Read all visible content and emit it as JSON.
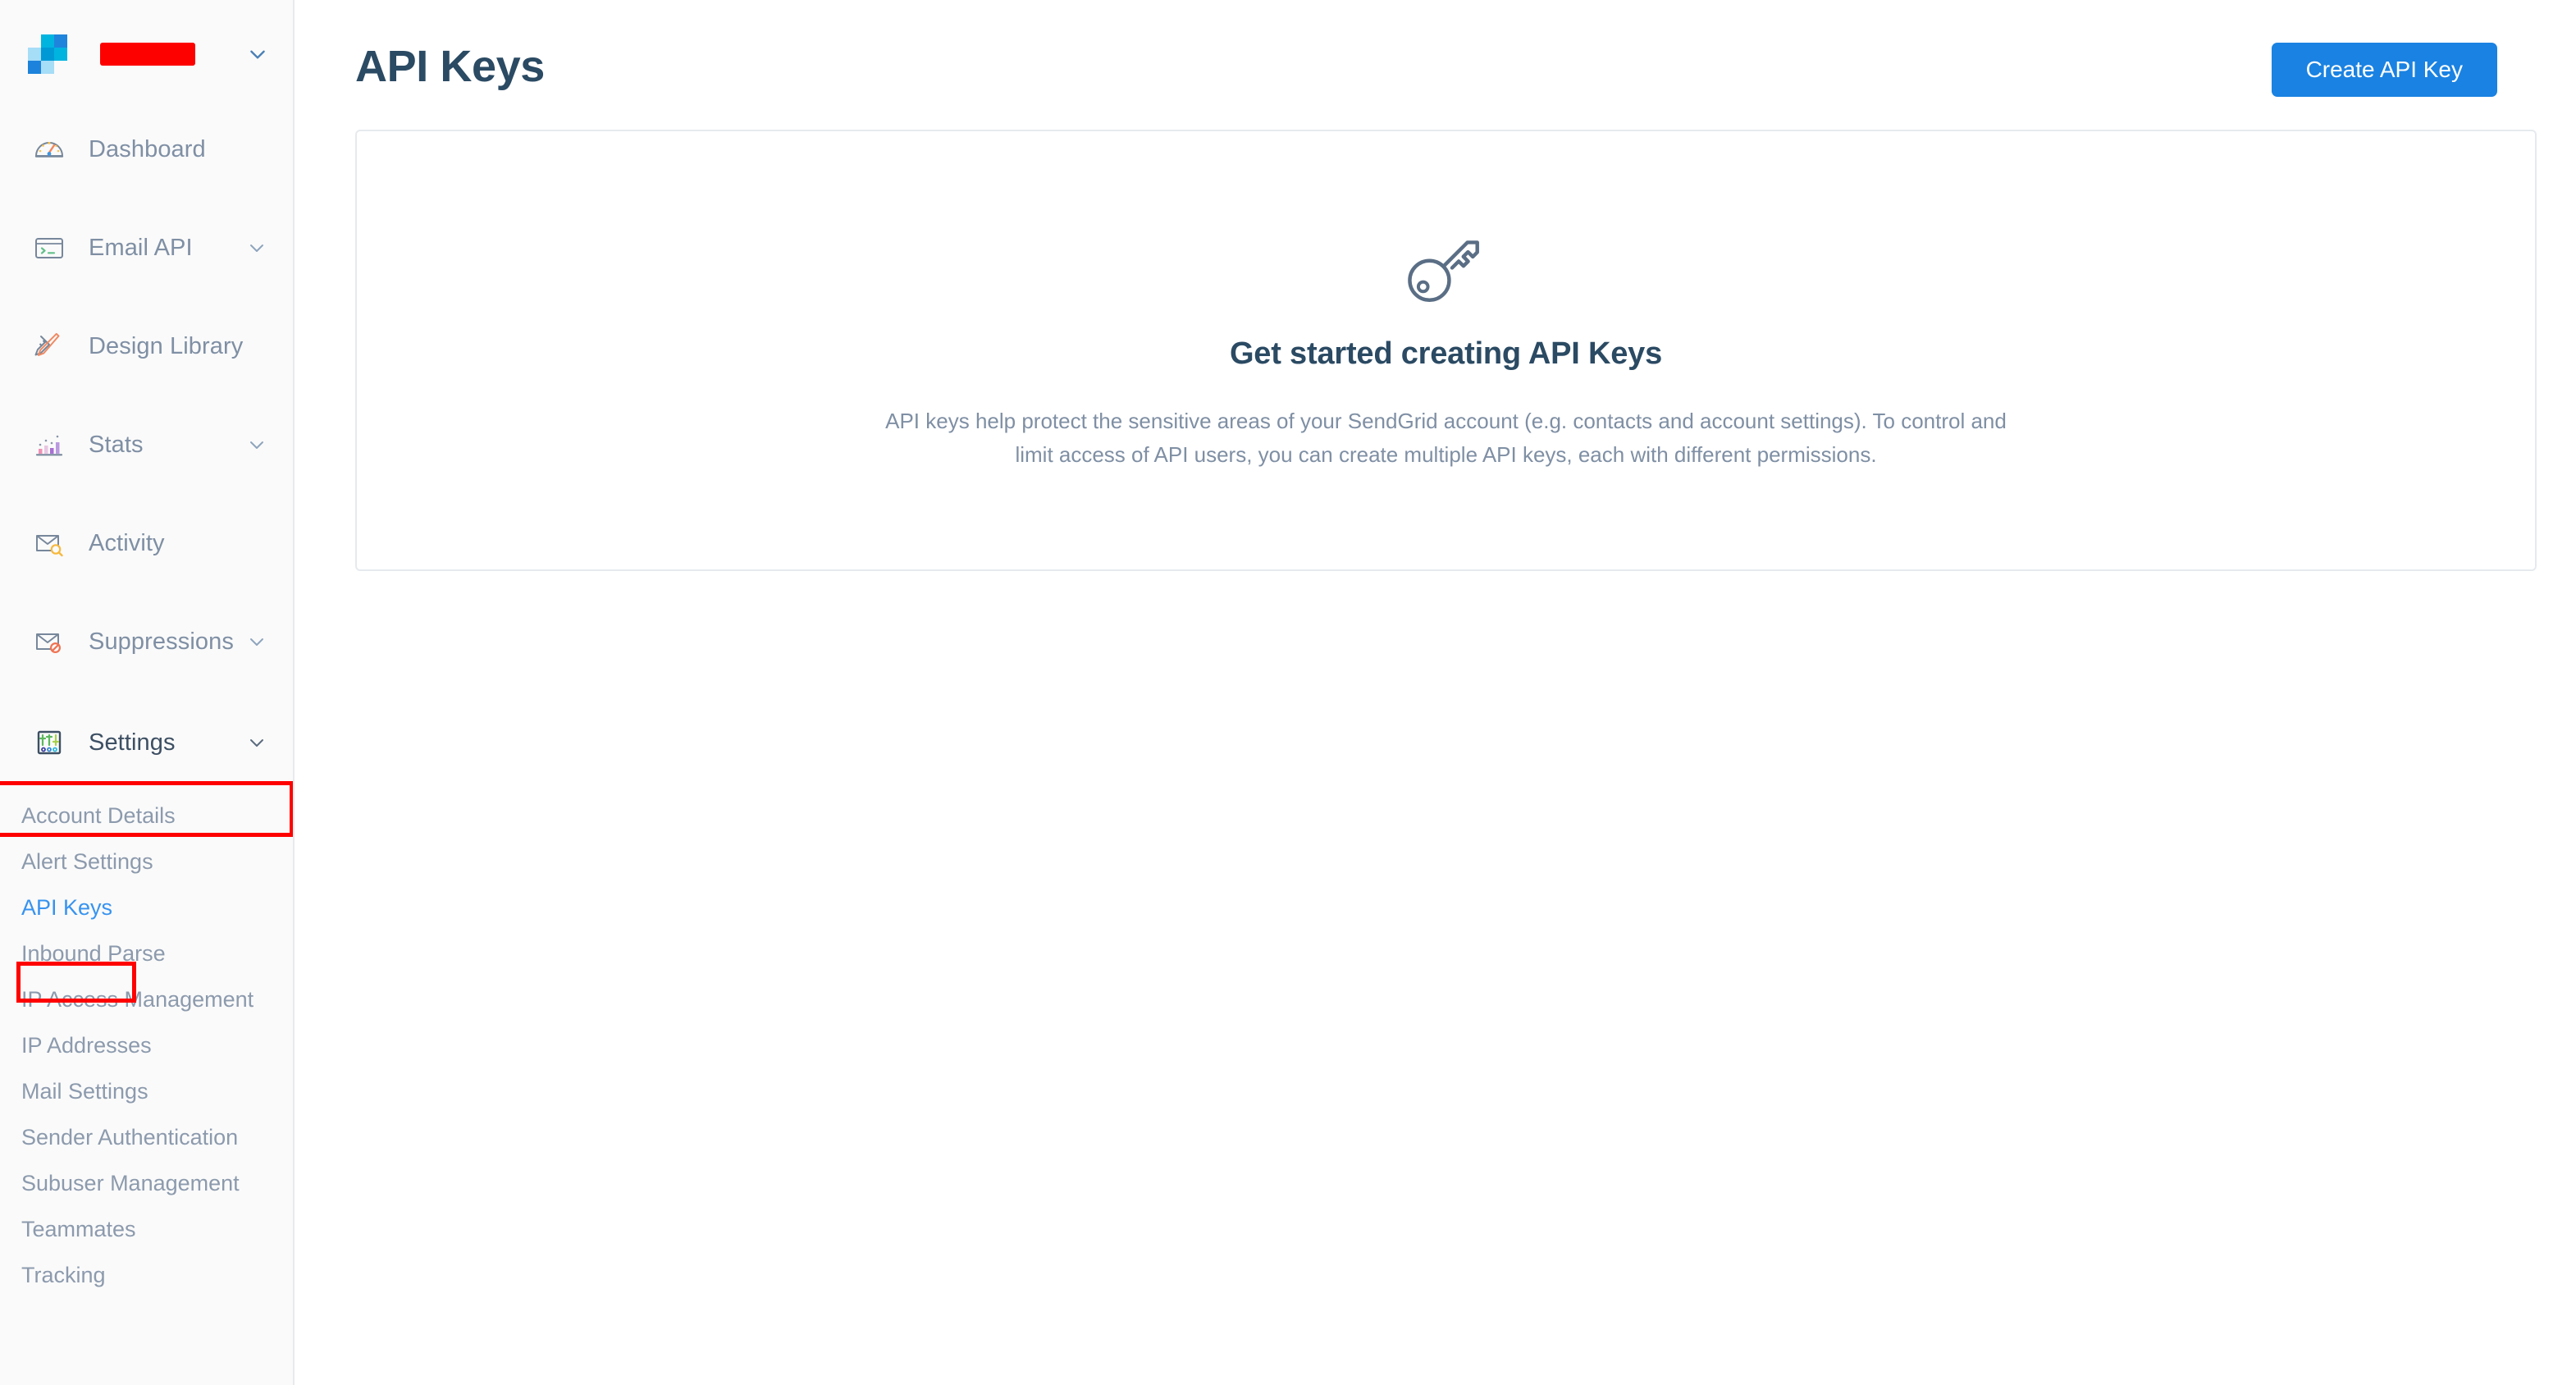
{
  "brand": {
    "logo_name": "sendgrid-logo",
    "account_name_redacted": true,
    "logo_colors": [
      "#9fdcf5",
      "#00b4e0",
      "#1f84dc",
      "#0099d6",
      "#a6ddf7",
      "#1d82db"
    ],
    "chevron_icon": "chevron-down-icon"
  },
  "sidebar": {
    "items": [
      {
        "label": "Dashboard",
        "icon": "dashboard-gauge-icon",
        "expandable": false
      },
      {
        "label": "Email API",
        "icon": "terminal-window-icon",
        "expandable": true
      },
      {
        "label": "Design Library",
        "icon": "pencil-ruler-icon",
        "expandable": false
      },
      {
        "label": "Stats",
        "icon": "bar-chart-icon",
        "expandable": true
      },
      {
        "label": "Activity",
        "icon": "envelope-search-icon",
        "expandable": false
      },
      {
        "label": "Suppressions",
        "icon": "envelope-blocked-icon",
        "expandable": true
      },
      {
        "label": "Settings",
        "icon": "sliders-icon",
        "expandable": true,
        "active": true,
        "highlighted": true
      }
    ],
    "submenu": [
      {
        "label": "Account Details",
        "active": false
      },
      {
        "label": "Alert Settings",
        "active": false
      },
      {
        "label": "API Keys",
        "active": true,
        "highlighted": true
      },
      {
        "label": "Inbound Parse",
        "active": false
      },
      {
        "label": "IP Access Management",
        "active": false
      },
      {
        "label": "IP Addresses",
        "active": false
      },
      {
        "label": "Mail Settings",
        "active": false
      },
      {
        "label": "Sender Authentication",
        "active": false
      },
      {
        "label": "Subuser Management",
        "active": false
      },
      {
        "label": "Teammates",
        "active": false
      },
      {
        "label": "Tracking",
        "active": false
      }
    ]
  },
  "header": {
    "title": "API Keys",
    "create_button_label": "Create API Key"
  },
  "empty_state": {
    "icon": "key-icon",
    "title": "Get started creating API Keys",
    "description": "API keys help protect the sensitive areas of your SendGrid account (e.g. contacts and account settings). To control and limit access of API users, you can create multiple API keys, each with different permissions."
  },
  "colors": {
    "accent_blue": "#1a82e2",
    "link_blue": "#3793f0",
    "heading_navy": "#2b4a63",
    "muted_text": "#7f8fa4",
    "annotation_red": "#fe0000",
    "sidebar_bg": "#fafafa",
    "card_border": "#e6eaee"
  }
}
